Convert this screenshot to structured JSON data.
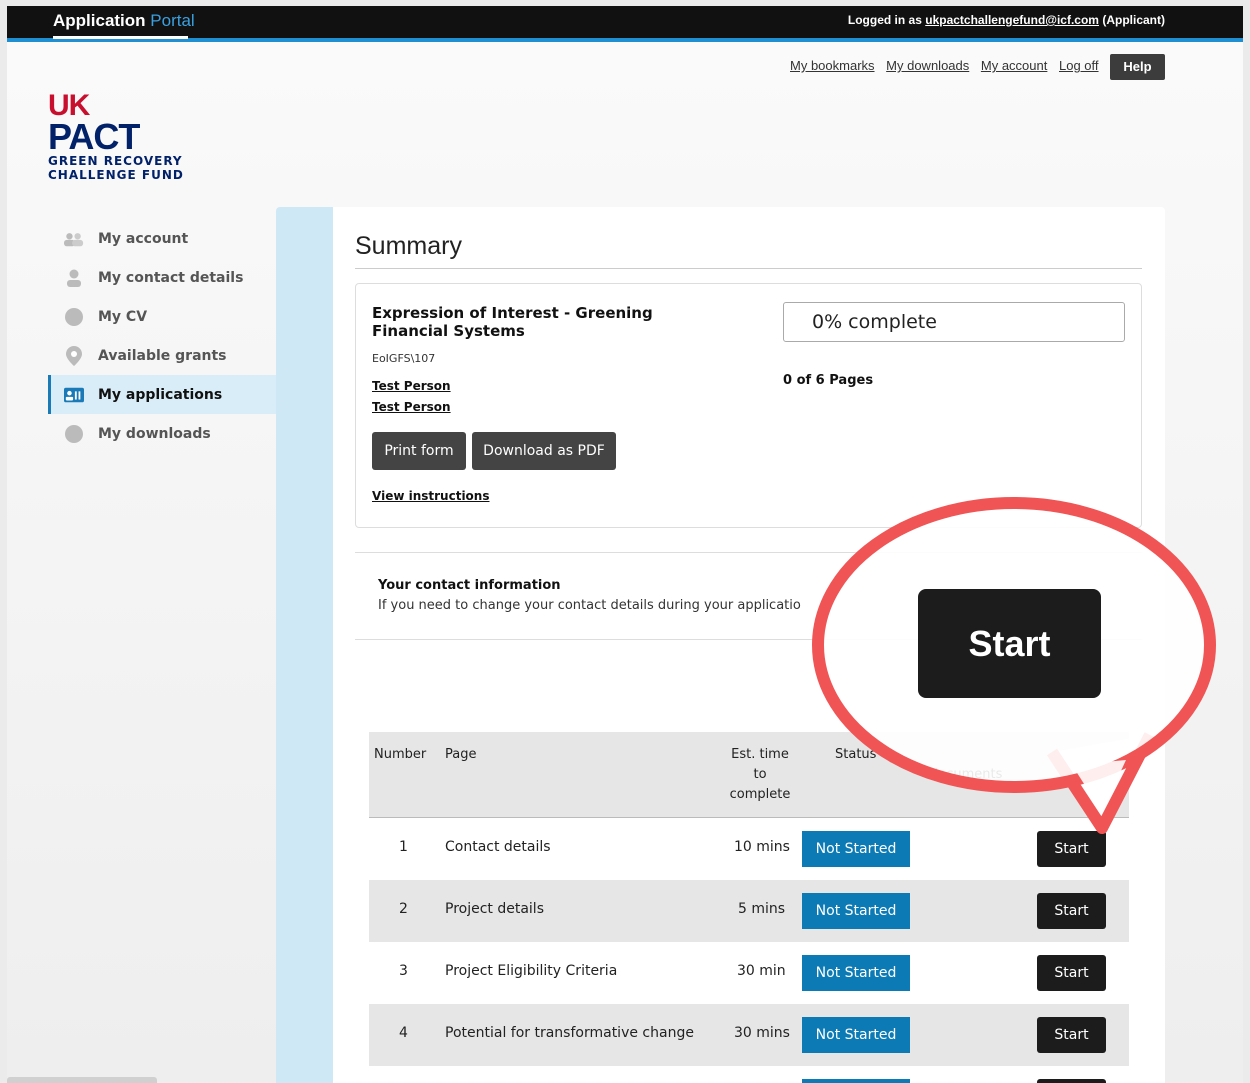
{
  "topbar": {
    "brand_main": "Application",
    "brand_sub": "Portal",
    "logged_in_prefix": "Logged in as",
    "email": "ukpactchallengefund@icf.com",
    "role": "(Applicant)"
  },
  "toplinks": {
    "bookmarks": "My bookmarks",
    "downloads": "My downloads",
    "account": "My account",
    "logoff": "Log off",
    "help": "Help"
  },
  "logo": {
    "uk": "UK",
    "pact": "PACT",
    "line1": "GREEN RECOVERY",
    "line2": "CHALLENGE FUND"
  },
  "sidebar": {
    "items": [
      {
        "label": "My account",
        "icon": "people-icon"
      },
      {
        "label": "My contact details",
        "icon": "person-icon"
      },
      {
        "label": "My CV",
        "icon": "circle-icon"
      },
      {
        "label": "Available grants",
        "icon": "map-pin-icon"
      },
      {
        "label": "My applications",
        "icon": "id-card-icon",
        "active": true
      },
      {
        "label": "My downloads",
        "icon": "circle-icon"
      }
    ]
  },
  "main": {
    "title": "Summary",
    "application": {
      "title": "Expression of Interest - Greening Financial Systems",
      "reference": "EoIGFS\\107",
      "persons": [
        "Test Person",
        "Test Person"
      ],
      "print_label": "Print form",
      "pdf_label": "Download as PDF",
      "instructions_label": "View instructions",
      "progress_text": "0% complete",
      "progress_value": 0,
      "pages_text": "0 of 6 Pages"
    },
    "contact": {
      "title": "Your contact information",
      "text": "If you need to change your contact details during your applicatio"
    },
    "table": {
      "headers": {
        "number": "Number",
        "page": "Page",
        "time_l1": "Est. time",
        "time_l2": "to",
        "time_l3": "complete",
        "status": "Status",
        "documents": "documents"
      },
      "rows": [
        {
          "number": "1",
          "page": "Contact details",
          "time": "10 mins",
          "status": "Not Started",
          "action": "Start"
        },
        {
          "number": "2",
          "page": "Project details",
          "time": "5 mins",
          "status": "Not Started",
          "action": "Start"
        },
        {
          "number": "3",
          "page": "Project Eligibility Criteria",
          "time": "30 min",
          "status": "Not Started",
          "action": "Start"
        },
        {
          "number": "4",
          "page": "Potential for transformative change",
          "time": "30 mins",
          "status": "Not Started",
          "action": "Start"
        }
      ]
    },
    "callout": {
      "label": "Start"
    }
  },
  "colors": {
    "status_blue": "#0c7bb5",
    "callout_red": "#f05454",
    "nav_active_bg": "#d9edf8",
    "side_strip": "#cfe8f6"
  }
}
